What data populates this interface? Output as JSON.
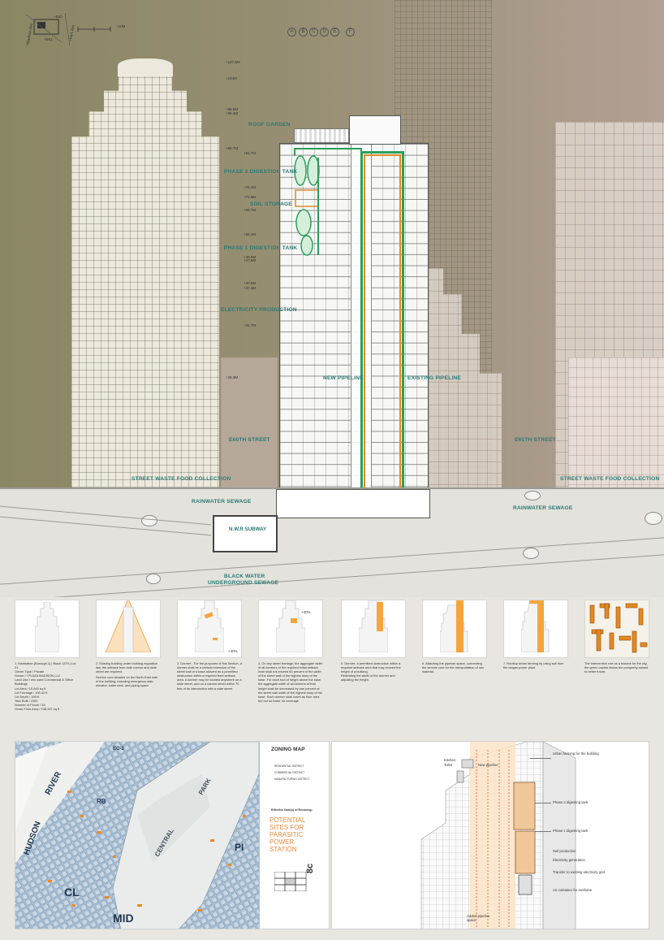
{
  "section": {
    "north": "N",
    "scale": "10M",
    "streets": {
      "madison": "Madison Ave",
      "park": "Park Ave",
      "e60": "E60",
      "e61": "E61"
    },
    "grid_axes": [
      "A",
      "B",
      "C",
      "D",
      "E",
      "F"
    ],
    "elevations": [
      "107.8M",
      "104M",
      "96.5M",
      "95.4M",
      "88.7M",
      "84.7M",
      "76.4M",
      "73.9M",
      "68.7M",
      "58.4M",
      "48.9M",
      "47.9M",
      "40.5M",
      "37.3M",
      "31.7M",
      "28.3M"
    ],
    "labels": {
      "roof_garden": "ROOF GARDEN",
      "phase2": "PHASE 2 DIGESTION TANK",
      "soil": "SOIL STORAGE",
      "phase1": "PHASE 1 DIGESTION TANK",
      "electricity": "ELECTRICITY PRODUCTION",
      "new_pipeline": "NEW PIPELINE",
      "existing_pipeline": "EXISTING PIPELINE",
      "e60": "E60TH STREET",
      "e61": "E61TH STREET",
      "swfc_left": "STREET WASTE FOOD COLLECTION",
      "swfc_right": "STREET WASTE FOOD COLLECTION",
      "rain_left": "RAINWATER SEWAGE",
      "rain_right": "RAINWATER SEWAGE",
      "subway": "N.W.R SUBWAY",
      "black_water": "BLACK WATER",
      "underground": "UNDERGROUND SEWAGE"
    }
  },
  "diagrams": [
    {
      "text": "1.  Manhattan (Borough 1) | Block 1375 | Lot 21\nOwner Type / Private\nOwner / I PLAZA MADISON LLC\nLand Use / mix used Commercial & Office Buildings\nLot Area / 10,045 sq ft\nLot Frontage / 100.42 ft\nLot Depth / 108 ft\nYear Built / 1951\nNumber of Floors / 34\nGross Floor Area / 108,347 sq ft"
    },
    {
      "text": "2. Existing building under building regulation law, the setback from both narrow and wide street are required.",
      "text_b": "Service core situated on the North-East side of the building, including emergency stair, elevator, water tank, and piping space"
    },
    {
      "text": "3. Dormer - For the purposes of this Section, a dormer shall be a vertical extension of the street wall of a base allowed as a permitted obstruction within a required front setback area. A dormer may be located anywhere on a wide street, and on a narrow street within 70 feet of its intersection with a wide street.",
      "pct": "40%"
    },
    {
      "text": "4. On any street frontage, the aggregate width of all dormers of the required initial setback level shall not exceed 60 percent of the width of the street wall of the highest story of the base. For each foot of height above the base, the aggregate width of all dormers at that height shall be decreased by one percent of the street wall width of the highest story of the base. Such dormer shall count as floor area but not as tower lot coverage",
      "pct": "40%"
    },
    {
      "text": "5. Dormer: a permitted obstruction within a required setback area that may exceed the height of a building.\nRedividing the width of the dormer and adjusting the height"
    },
    {
      "text": "6. Attaching the pipeline space, connecting the service core for the transportation of raw material."
    },
    {
      "text": "7. Rooftop urban farming by using soil from the biogas power plant."
    },
    {
      "text": "The intervention role as a biotone for the city, the green capital shows the prosperity toward to better future."
    }
  ],
  "map": {
    "code": "8c",
    "legend_title": "ZONING MAP",
    "legend_items": [
      "RESIDENTIAL DISTRICT",
      "COMMERCIAL DISTRICT",
      "MANUFACTURING DISTRICT"
    ],
    "legend_small": "Effective Date(s) of Rezoning:",
    "potential": [
      "POTENTIAL",
      "SITES FOR",
      "PARASITIC",
      "POWER",
      "STATION"
    ],
    "districts": [
      "HUDSON",
      "RIVER",
      "CENTRAL",
      "PARK",
      "CL",
      "MID",
      "PI",
      "EC-3",
      "RB"
    ]
  },
  "axo": {
    "labels": [
      "Urban farming for the building",
      "Phase 2 digesting tank",
      "Phase 1 digesting tank",
      "Soil production",
      "Electricity generation",
      "Transfer to existing electricity grid",
      "Air container for methane",
      "New pipeline",
      "Kitchen",
      "Toilet",
      "Added pipeline space"
    ]
  }
}
